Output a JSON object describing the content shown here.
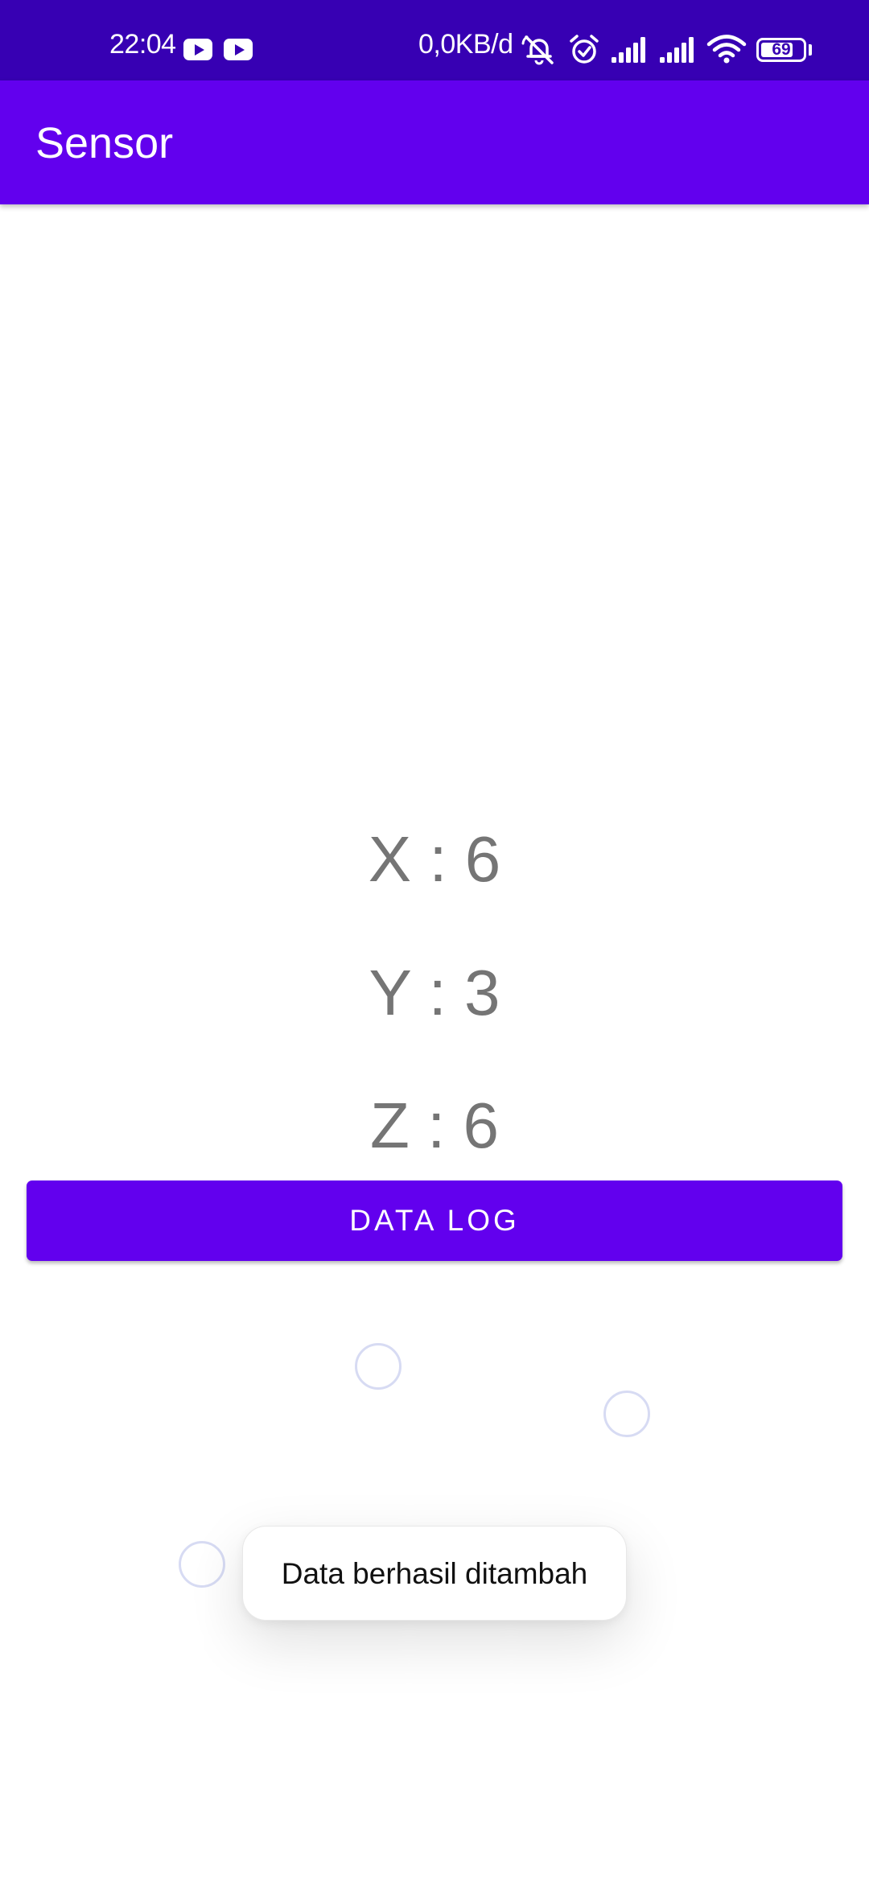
{
  "status_bar": {
    "time": "22:04",
    "net_speed": "0,0KB/d",
    "battery_level": "69",
    "icons": [
      "youtube-icon",
      "youtube-icon",
      "notifications-muted-icon",
      "alarm-icon",
      "signal-icon",
      "signal-icon",
      "wifi-icon",
      "battery-icon"
    ]
  },
  "app_bar": {
    "title": "Sensor"
  },
  "sensor": {
    "x": "X : 6",
    "y": "Y : 3",
    "z": "Z : 6"
  },
  "button": {
    "label": "DATA LOG"
  },
  "toast": {
    "message": "Data berhasil ditambah"
  },
  "colors": {
    "status_bar": "#3700b3",
    "primary": "#6200ee",
    "value_text": "#757575",
    "background": "#ffffff"
  }
}
